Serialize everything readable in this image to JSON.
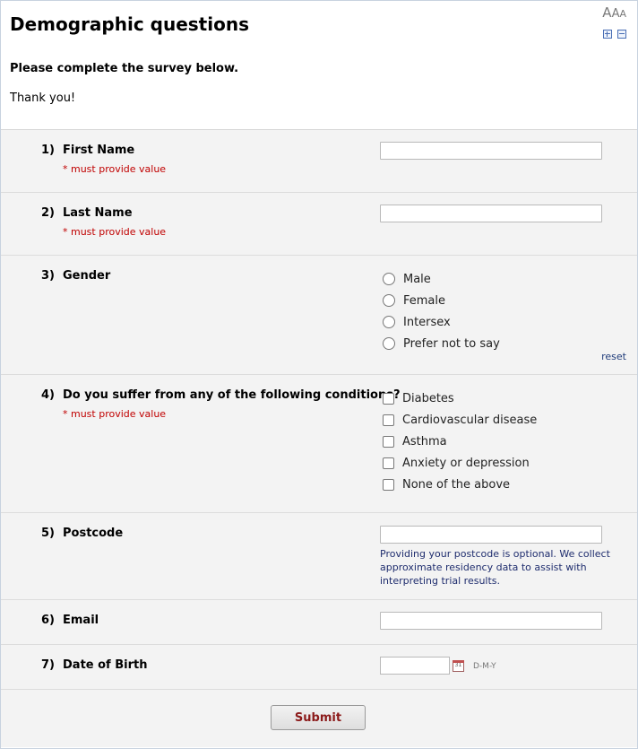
{
  "header": {
    "title": "Demographic questions",
    "instructions": "Please complete the survey below.",
    "thanks": "Thank you!",
    "font_resize": [
      "A",
      "A",
      "A"
    ]
  },
  "required_note": "* must provide value",
  "questions": [
    {
      "num": "1)",
      "label": "First Name"
    },
    {
      "num": "2)",
      "label": "Last Name"
    },
    {
      "num": "3)",
      "label": "Gender",
      "options": [
        "Male",
        "Female",
        "Intersex",
        "Prefer not to say"
      ],
      "reset": "reset"
    },
    {
      "num": "4)",
      "label": "Do you suffer from any of the following conditions?",
      "options": [
        "Diabetes",
        "Cardiovascular disease",
        "Asthma",
        "Anxiety or depression",
        "None of the above"
      ]
    },
    {
      "num": "5)",
      "label": "Postcode",
      "note": "Providing your postcode is optional. We collect approximate residency data to assist with interpreting trial results."
    },
    {
      "num": "6)",
      "label": "Email"
    },
    {
      "num": "7)",
      "label": "Date of Birth",
      "date_format": "D-M-Y",
      "calendar_digits": "31"
    }
  ],
  "submit_label": "Submit",
  "icons": {
    "calendar": "calendar-icon",
    "zoom_in": "plus-box-icon",
    "zoom_out": "minus-box-icon"
  }
}
